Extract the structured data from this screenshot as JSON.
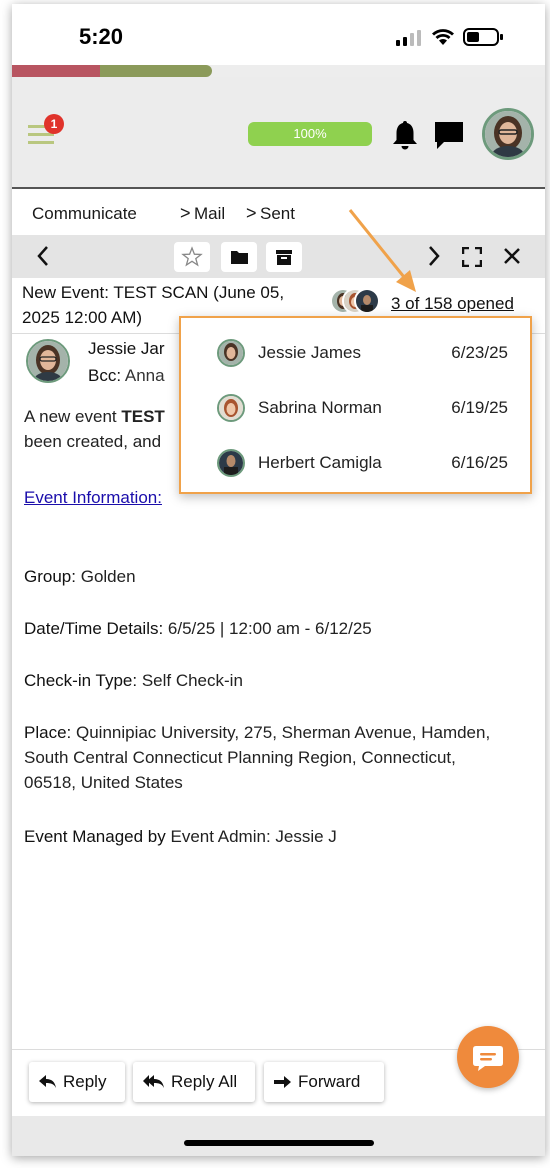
{
  "status_bar": {
    "time": "5:20"
  },
  "header": {
    "menu_badge": "1",
    "progress_label": "100%",
    "progress_value": 1.0
  },
  "breadcrumb": {
    "items": [
      "Communicate",
      "Mail",
      "Sent"
    ]
  },
  "email": {
    "subject_line1": "New Event: TEST SCAN (June 05,",
    "subject_line2": "2025 12:00 AM)",
    "opened_text": "3 of 158 opened",
    "sender_name": "Jessie Jar",
    "bcc_label": "Bcc:",
    "bcc_value": "Anna",
    "intro_line1_start": "A new event ",
    "intro_line1_bold": "TEST",
    "intro_line2": "been created, and",
    "event_link": "Event Information:",
    "fields": [
      {
        "label": "Group:",
        "value": "Golden"
      },
      {
        "label": "Date/Time Details:",
        "value": "6/5/25 | 12:00 am - 6/12/25"
      },
      {
        "label": "Check-in Type:",
        "value": "Self Check-in"
      },
      {
        "label": "Place:",
        "value": "Quinnipiac University, 275, Sherman Avenue, Hamden, South Central Connecticut Planning Region, Connecticut, 06518, United States"
      },
      {
        "label": "Event Managed by",
        "value": "Event Admin: Jessie J"
      }
    ]
  },
  "opened_popup": {
    "rows": [
      {
        "name": "Jessie James",
        "date": "6/23/25"
      },
      {
        "name": "Sabrina Norman",
        "date": "6/19/25"
      },
      {
        "name": "Herbert Camigla",
        "date": "6/16/25"
      }
    ]
  },
  "footer": {
    "reply": "Reply",
    "reply_all": "Reply All",
    "forward": "Forward"
  },
  "colors": {
    "accent_orange": "#ef8a3c",
    "progress_green": "#8fd14f",
    "link_blue": "#1a0dab",
    "badge_red": "#e0332b"
  },
  "icons": [
    "signal-icon",
    "wifi-icon",
    "battery-icon",
    "menu-icon",
    "bell-icon",
    "chat-icon",
    "back-icon",
    "star-icon",
    "folder-icon",
    "archive-icon",
    "next-icon",
    "expand-icon",
    "close-icon",
    "reply-icon",
    "reply-all-icon",
    "forward-icon",
    "chat-bubble-icon"
  ]
}
